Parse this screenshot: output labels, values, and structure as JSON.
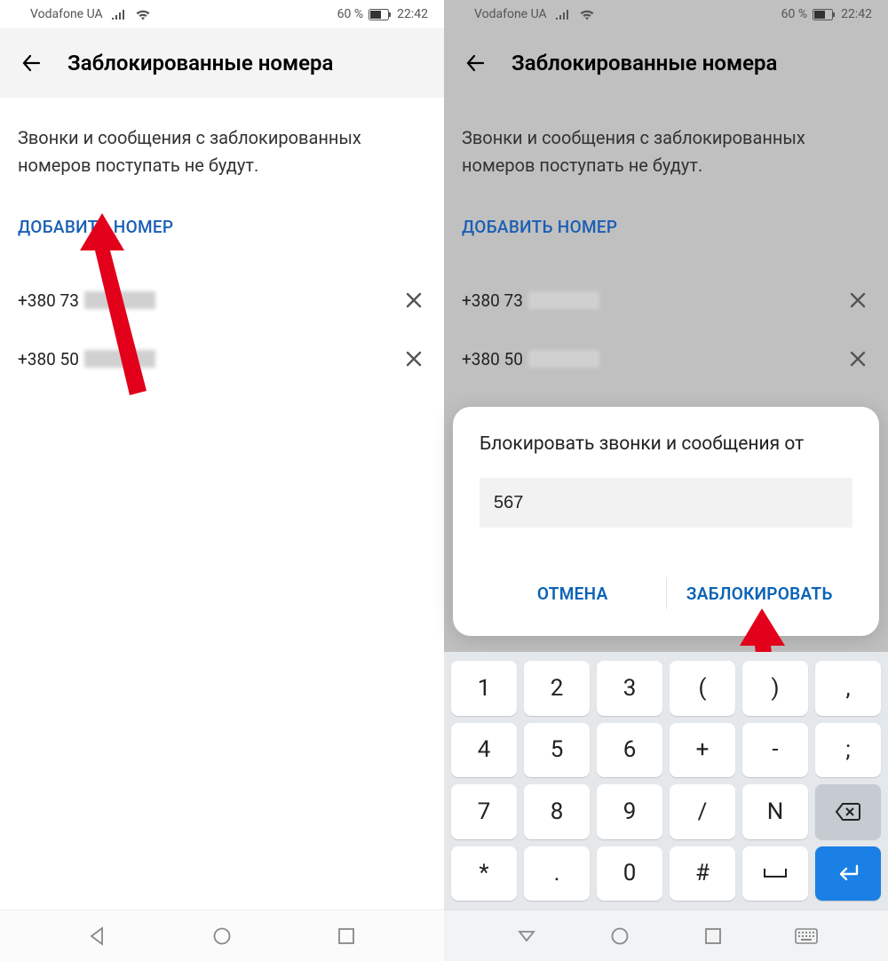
{
  "status": {
    "carrier": "Vodafone UA",
    "battery_text": "60 %",
    "time": "22:42"
  },
  "header": {
    "title": "Заблокированные номера"
  },
  "body": {
    "description": "Звонки и сообщения с заблокированных номеров поступать не будут.",
    "add_number": "ДОБАВИТЬ НОМЕР"
  },
  "numbers": [
    {
      "prefix": "+380 73"
    },
    {
      "prefix": "+380 50"
    }
  ],
  "dialog": {
    "title": "Блокировать звонки и сообщения от",
    "input_value": "567",
    "cancel": "ОТМЕНА",
    "confirm": "ЗАБЛОКИРОВАТЬ"
  },
  "keypad": [
    [
      "1",
      "2",
      "3",
      "(",
      ")",
      ","
    ],
    [
      "4",
      "5",
      "6",
      "+",
      "-",
      ";"
    ],
    [
      "7",
      "8",
      "9",
      "/",
      "N",
      "⌫"
    ],
    [
      "*",
      ".",
      "0",
      "#",
      " ",
      "↵"
    ]
  ]
}
